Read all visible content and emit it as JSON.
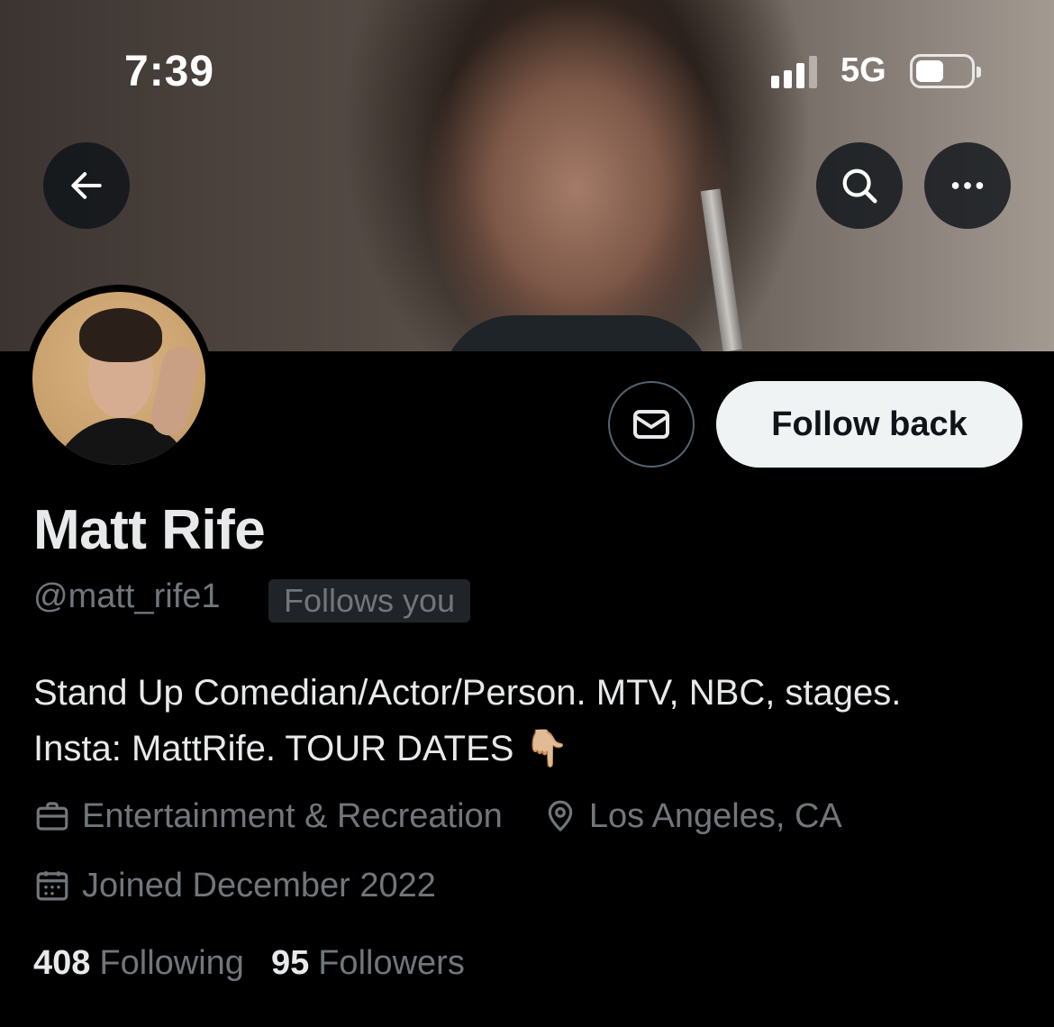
{
  "status_bar": {
    "time": "7:39",
    "network": "5G",
    "signal_bars": 4,
    "signal_bars_lit": 3,
    "battery_level": 0.5
  },
  "header": {
    "back_icon": "arrow-left-icon",
    "search_icon": "search-icon",
    "more_icon": "more-horizontal-icon"
  },
  "profile": {
    "display_name": "Matt Rife",
    "handle": "@matt_rife1",
    "follows_you_badge": "Follows you",
    "bio_line1": "Stand Up Comedian/Actor/Person. MTV, NBC, stages.",
    "bio_line2": "Insta: MattRife. TOUR DATES",
    "bio_emoji": "👇🏼",
    "category": "Entertainment & Recreation",
    "location": "Los Angeles, CA",
    "joined": "Joined December 2022"
  },
  "actions": {
    "follow_label": "Follow back",
    "message_icon": "envelope-icon"
  },
  "stats": {
    "following_count": "408",
    "following_label": "Following",
    "followers_count": "95",
    "followers_label": "Followers"
  },
  "colors": {
    "background": "#000000",
    "primary_text": "#e7e9ea",
    "secondary_text": "#71767b",
    "button_bg": "#eff3f4",
    "badge_bg": "#202327"
  }
}
